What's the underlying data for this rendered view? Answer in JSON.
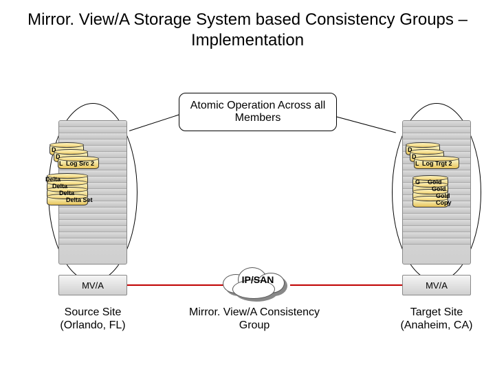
{
  "title": "Mirror. View/A Storage System based Consistency Groups – Implementation",
  "atomic_caption": "Atomic Operation Across all Members",
  "left": {
    "mv": "MV/A",
    "site_line1": "Source Site",
    "site_line2": "(Orlando, FL)",
    "top_cyl_fragment": "D",
    "top_cyl2_fragment": "D",
    "log_src_prefix": "L",
    "log_src": "Log Src 2",
    "delta_prefix": "Delta",
    "delta1": "Delta",
    "delta2": "Delta",
    "delta_set": "Delta Set"
  },
  "right": {
    "mv": "MV/A",
    "site_line1": "Target Site",
    "site_line2": "(Anaheim, CA)",
    "top_cyl_fragment": "D",
    "top_cyl2_fragment": "D",
    "log_prefix": "L",
    "log_trgt": "Log Trgt 2",
    "gold_prefix": "G",
    "gold1": "Gold",
    "gold2": "Gold",
    "gold3": "Gold",
    "copy": "Copy"
  },
  "cloud_label": "IP/SAN",
  "cg_line1": "Mirror. View/A Consistency",
  "cg_line2": "Group"
}
